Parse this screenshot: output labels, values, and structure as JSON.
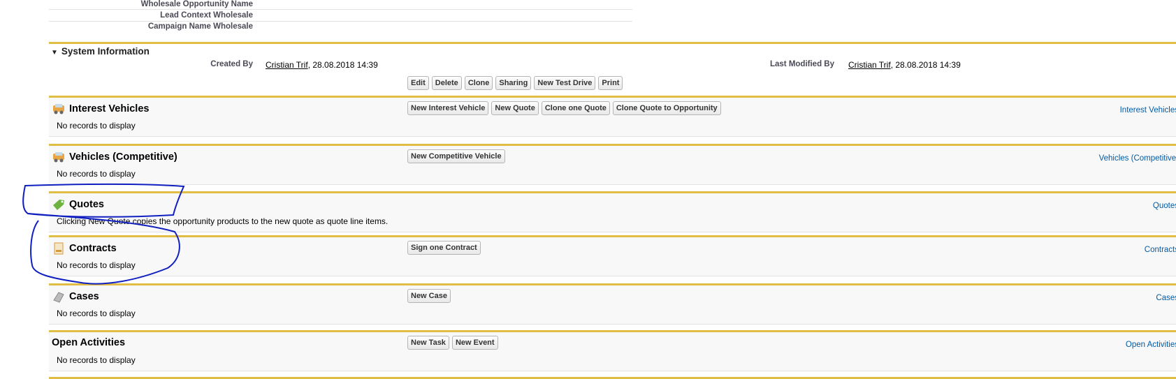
{
  "top_fields": [
    {
      "label": "Wholesale Opportunity Name"
    },
    {
      "label": "Lead Context Wholesale"
    },
    {
      "label": "Campaign Name Wholesale"
    }
  ],
  "system_info": {
    "title": "System Information",
    "created_by_label": "Created By",
    "created_by_user": "Cristian Trif",
    "created_by_date": ", 28.08.2018 14:39",
    "modified_by_label": "Last Modified By",
    "modified_by_user": "Cristian Trif",
    "modified_by_date": ", 28.08.2018 14:39"
  },
  "detail_buttons": [
    "Edit",
    "Delete",
    "Clone",
    "Sharing",
    "New Test Drive",
    "Print"
  ],
  "sections": [
    {
      "title": "Interest Vehicles",
      "icon": "vehicle-icon",
      "body": "No records to display",
      "buttons": [
        "New Interest Vehicle",
        "New Quote",
        "Clone one Quote",
        "Clone Quote to Opportunity"
      ],
      "link": "Interest Vehicles"
    },
    {
      "title": "Vehicles (Competitive)",
      "icon": "vehicle-icon",
      "body": "No records to display",
      "buttons": [
        "New Competitive Vehicle"
      ],
      "link": "Vehicles (Competitive)"
    },
    {
      "title": "Quotes",
      "icon": "quote-tag-icon",
      "body": "Clicking New Quote copies the opportunity products to the new quote as quote line items.",
      "buttons": [],
      "link": "Quotes"
    },
    {
      "title": "Contracts",
      "icon": "contract-icon",
      "body": "No records to display",
      "buttons": [
        "Sign one Contract"
      ],
      "link": "Contracts"
    },
    {
      "title": "Cases",
      "icon": "case-icon",
      "body": "No records to display",
      "buttons": [
        "New Case"
      ],
      "link": "Cases"
    },
    {
      "title": "Open Activities",
      "icon": "",
      "body": "No records to display",
      "buttons": [
        "New Task",
        "New Event"
      ],
      "link": "Open Activities"
    }
  ],
  "colors": {
    "accent_gold": "#e0bd45",
    "link_blue": "#015ba7",
    "annotation_blue": "#1020c0"
  }
}
